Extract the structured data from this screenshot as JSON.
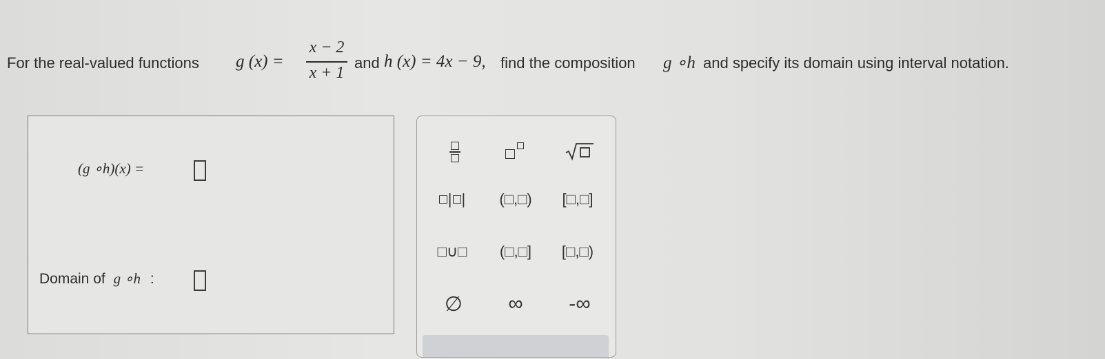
{
  "question": {
    "intro": "For the real-valued functions",
    "g_def": "g (x) =",
    "g_numerator": "x − 2",
    "g_denominator": "x + 1",
    "and_text": "and",
    "h_def": "h (x) = 4x − 9,",
    "find_text": "find the composition",
    "composition": "g ∘h",
    "outro": "and specify its domain using interval notation."
  },
  "answer": {
    "composition_label": "(g ∘h)(x) =",
    "domain_label": "Domain of",
    "domain_func": "g ∘h",
    "domain_colon": ":"
  },
  "palette": {
    "buttons": [
      {
        "name": "fraction-button",
        "label": "fraction"
      },
      {
        "name": "superscript-button",
        "label": "exponent"
      },
      {
        "name": "square-root-button",
        "label": "sqrt"
      },
      {
        "name": "absolute-value-button",
        "label": "abs"
      },
      {
        "name": "open-interval-button",
        "label": "(□,□)"
      },
      {
        "name": "closed-interval-button",
        "label": "[□,□]"
      },
      {
        "name": "union-button",
        "label": "□∪□"
      },
      {
        "name": "left-open-interval-button",
        "label": "(□,□]"
      },
      {
        "name": "right-open-interval-button",
        "label": "[□,□)"
      },
      {
        "name": "empty-set-button",
        "label": "∅"
      },
      {
        "name": "infinity-button",
        "label": "∞"
      },
      {
        "name": "negative-infinity-button",
        "label": "-∞"
      }
    ],
    "empty_set": "∅",
    "infinity": "∞",
    "neg_infinity": "-∞"
  }
}
